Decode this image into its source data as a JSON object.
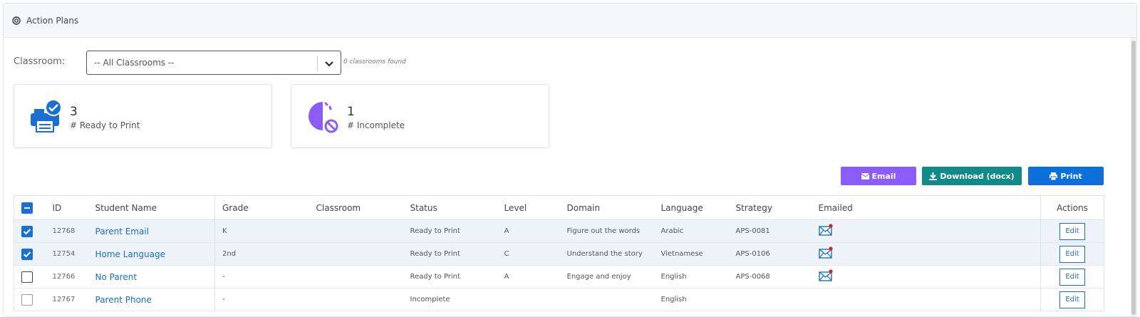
{
  "header": {
    "title": "Action Plans",
    "icon": "target-icon"
  },
  "filter": {
    "label": "Classroom:",
    "selected": "-- All Classrooms --",
    "found_text": "0 classrooms found"
  },
  "cards": [
    {
      "value": "3",
      "label": "# Ready to Print",
      "icon": "printer-check-icon"
    },
    {
      "value": "1",
      "label": "# Incomplete",
      "icon": "incomplete-clock-icon"
    }
  ],
  "buttons": {
    "email": "Email",
    "download": "Download (docx)",
    "print": "Print"
  },
  "colors": {
    "email": "#8b5cf6",
    "download": "#138a8a",
    "print": "#0d6fd9",
    "link": "#1a6fc4"
  },
  "table": {
    "headers": {
      "id": "ID",
      "name": "Student Name",
      "grade": "Grade",
      "classroom": "Classroom",
      "status": "Status",
      "level": "Level",
      "domain": "Domain",
      "language": "Language",
      "strategy": "Strategy",
      "emailed": "Emailed",
      "actions": "Actions"
    },
    "edit_label": "Edit",
    "rows": [
      {
        "checked": true,
        "id": "12768",
        "name": "Parent Email",
        "grade": "K",
        "classroom": "",
        "status": "Ready to Print",
        "level": "A",
        "domain": "Figure out the words",
        "language": "Arabic",
        "strategy": "APS-0081",
        "emailed": true
      },
      {
        "checked": true,
        "id": "12754",
        "name": "Home Language",
        "grade": "2nd",
        "classroom": "",
        "status": "Ready to Print",
        "level": "C",
        "domain": "Understand the story",
        "language": "Vietnamese",
        "strategy": "APS-0106",
        "emailed": true
      },
      {
        "checked": false,
        "id": "12766",
        "name": "No Parent",
        "grade": "-",
        "classroom": "",
        "status": "Ready to Print",
        "level": "A",
        "domain": "Engage and enjoy",
        "language": "English",
        "strategy": "APS-0068",
        "emailed": true
      },
      {
        "checked": false,
        "id": "12767",
        "name": "Parent Phone",
        "grade": "-",
        "classroom": "",
        "status": "Incomplete",
        "level": "",
        "domain": "",
        "language": "English",
        "strategy": "",
        "emailed": false
      }
    ]
  }
}
